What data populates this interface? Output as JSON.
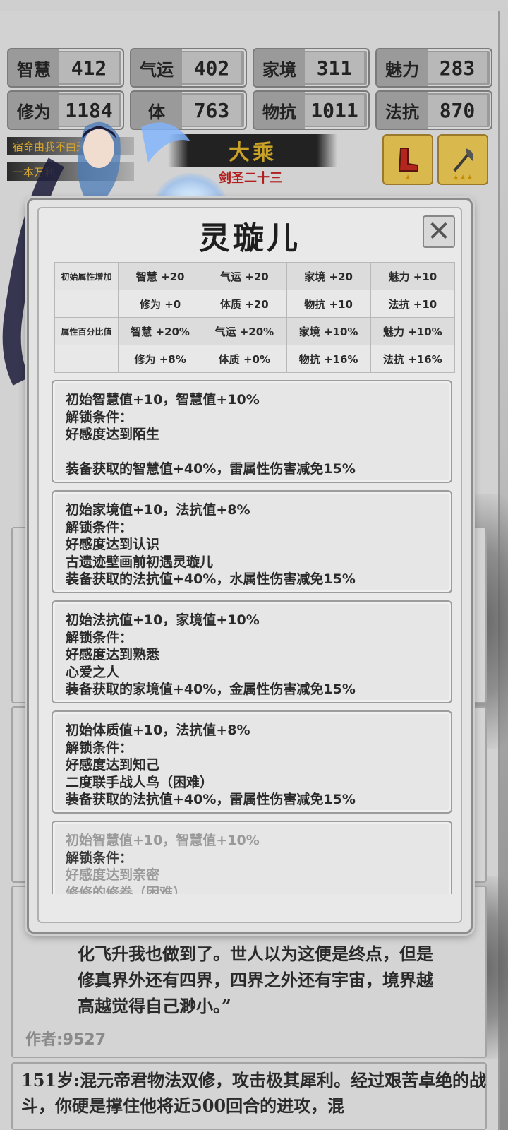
{
  "stats": [
    {
      "label": "智慧",
      "value": "412"
    },
    {
      "label": "气运",
      "value": "402"
    },
    {
      "label": "家境",
      "value": "311"
    },
    {
      "label": "魅力",
      "value": "283"
    },
    {
      "label": "修为",
      "value": "1184"
    },
    {
      "label": "体",
      "value": "763"
    },
    {
      "label": "物抗",
      "value": "1011"
    },
    {
      "label": "法抗",
      "value": "870"
    }
  ],
  "character": {
    "realm": "大乘",
    "title": "剑圣二十三",
    "skills": [
      "宿命由我不由天",
      "一本万利"
    ]
  },
  "modal": {
    "title": "灵璇儿",
    "close_glyph": "✕",
    "attr_table": {
      "row_heads": [
        "初始属性增加",
        "",
        "属性百分比值",
        ""
      ],
      "rows": [
        [
          "智慧 +20",
          "气运 +20",
          "家境 +20",
          "魅力 +10"
        ],
        [
          "修为 +0",
          "体质 +20",
          "物抗 +10",
          "法抗 +10"
        ],
        [
          "智慧 +20%",
          "气运 +20%",
          "家境 +10%",
          "魅力 +10%"
        ],
        [
          "修为 +8%",
          "体质 +0%",
          "物抗 +16%",
          "法抗 +16%"
        ]
      ]
    },
    "bonuses": [
      {
        "lines": [
          "初始智慧值+10，智慧值+10%",
          "解锁条件：",
          "好感度达到陌生",
          "",
          "装备获取的智慧值+40%，雷属性伤害减免15%"
        ],
        "locked": false
      },
      {
        "lines": [
          "初始家境值+10，法抗值+8%",
          "解锁条件：",
          "好感度达到认识",
          "古遗迹壁画前初遇灵璇儿",
          "装备获取的法抗值+40%，水属性伤害减免15%"
        ],
        "locked": false
      },
      {
        "lines": [
          "初始法抗值+10，家境值+10%",
          "解锁条件：",
          "好感度达到熟悉",
          "心爱之人",
          "装备获取的家境值+40%，金属性伤害减免15%"
        ],
        "locked": false
      },
      {
        "lines": [
          "初始体质值+10，法抗值+8%",
          "解锁条件：",
          "好感度达到知己",
          "二度联手战人鸟（困难）",
          "装备获取的法抗值+40%，雷属性伤害减免15%"
        ],
        "locked": false
      },
      {
        "lines": [
          "初始智慧值+10，智慧值+10%",
          "解锁条件：",
          "好感度达到亲密",
          "修修的修卷（困难）"
        ],
        "locked": true
      }
    ]
  },
  "story": {
    "lines": [
      "化飞升我也做到了。世人以为这便是终点，但是",
      "修真界外还有四界，四界之外还有宇宙，境界越",
      "高越觉得自己渺小。”"
    ],
    "author": "作者:9527",
    "next_entry": "151岁:混元帝君物法双修，攻击极其犀利。经过艰苦卓绝的战斗，你硬是撑住他将近500回合的进攻，混"
  }
}
